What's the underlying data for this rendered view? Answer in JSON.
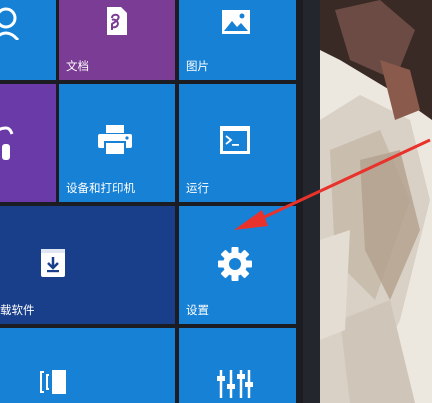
{
  "start_menu": {
    "tiles": {
      "people": {
        "label": "",
        "icon": "person-icon"
      },
      "documents": {
        "label": "文档",
        "icon": "document-icon"
      },
      "pictures": {
        "label": "图片",
        "icon": "picture-icon"
      },
      "music": {
        "label": "",
        "icon": "headphones-icon"
      },
      "devices_printers": {
        "label": "设备和打印机",
        "icon": "printer-icon"
      },
      "run": {
        "label": "运行",
        "icon": "terminal-icon"
      },
      "downloads": {
        "label": "载软件",
        "icon": "download-box-icon"
      },
      "settings": {
        "label": "设置",
        "icon": "gear-icon"
      },
      "bottom_left": {
        "label": "",
        "icon": "panel-icon"
      },
      "bottom_right": {
        "label": "",
        "icon": "sliders-icon"
      }
    }
  },
  "colors": {
    "tile_blue": "#1781d6",
    "tile_purple": "#7a3c95",
    "tile_dark_blue": "#1a3f8a",
    "annotation_arrow": "#e8322b"
  }
}
